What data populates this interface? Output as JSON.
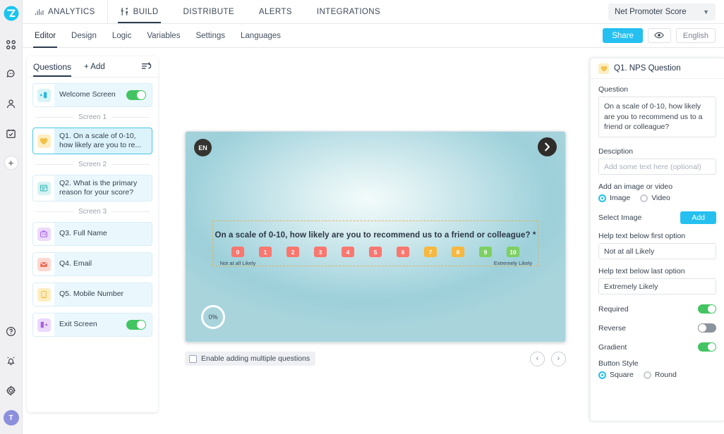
{
  "brand": {
    "accent": "#25c0f0",
    "dark": "#2b3a4d",
    "green": "#43c463"
  },
  "rail": {
    "logo_label": "zonka-logo",
    "items": [
      {
        "name": "apps-grid-icon"
      },
      {
        "name": "chat-bubble-icon"
      },
      {
        "name": "person-icon"
      },
      {
        "name": "calendar-check-icon"
      }
    ],
    "add_label": "+",
    "bottom": [
      {
        "name": "help-circle-icon"
      },
      {
        "name": "bell-icon"
      },
      {
        "name": "gear-icon"
      }
    ],
    "avatar_initial": "T"
  },
  "topbar": {
    "nav": [
      {
        "label": "ANALYTICS",
        "icon": "bar-chart-icon",
        "active": false
      },
      {
        "label": "BUILD",
        "icon": "wrench-tools-icon",
        "active": true
      },
      {
        "label": "DISTRIBUTE",
        "icon": "",
        "active": false
      },
      {
        "label": "ALERTS",
        "icon": "",
        "active": false
      },
      {
        "label": "INTEGRATIONS",
        "icon": "",
        "active": false
      }
    ],
    "survey_select": {
      "value": "Net Promoter Score",
      "chevron": "chevron-down-icon"
    }
  },
  "subbar": {
    "tabs": [
      {
        "label": "Editor",
        "active": true
      },
      {
        "label": "Design",
        "active": false
      },
      {
        "label": "Logic",
        "active": false
      },
      {
        "label": "Variables",
        "active": false
      },
      {
        "label": "Settings",
        "active": false
      },
      {
        "label": "Languages",
        "active": false
      }
    ],
    "share_label": "Share",
    "preview_icon": "eye-icon",
    "language_label": "English"
  },
  "questions_panel": {
    "title": "Questions",
    "add_label": "+ Add",
    "reorder_icon": "reorder-undo-icon",
    "items": [
      {
        "kind": "screen",
        "label": "Welcome Screen",
        "icon": "welcome-screen-icon",
        "icon_bg": "#d8f4f7",
        "icon_color": "#2bb8d6",
        "toggle": true
      },
      {
        "kind": "separator",
        "label": "Screen 1"
      },
      {
        "kind": "question",
        "label": "Q1. On a scale of 0-10, how likely are you to re...",
        "icon": "heart-icon",
        "icon_bg": "#fdeec2",
        "icon_color": "#f3c14a",
        "selected": true
      },
      {
        "kind": "separator",
        "label": "Screen 2"
      },
      {
        "kind": "question",
        "label": "Q2. What is the primary reason for your score?",
        "icon": "comment-box-icon",
        "icon_bg": "#d7f3f2",
        "icon_color": "#3ab9bd",
        "selected": false
      },
      {
        "kind": "separator",
        "label": "Screen 3"
      },
      {
        "kind": "question",
        "label": "Q3. Full Name",
        "icon": "id-badge-icon",
        "icon_bg": "#ecd9fb",
        "icon_color": "#a861e8",
        "selected": false
      },
      {
        "kind": "question",
        "label": "Q4. Email",
        "icon": "envelope-icon",
        "icon_bg": "#fbd9d2",
        "icon_color": "#ee6a52",
        "selected": false
      },
      {
        "kind": "question",
        "label": "Q5. Mobile Number",
        "icon": "mobile-phone-icon",
        "icon_bg": "#fdeec2",
        "icon_color": "#f0bb3e",
        "selected": false
      },
      {
        "kind": "screen",
        "label": "Exit Screen",
        "icon": "exit-screen-icon",
        "icon_bg": "#ecd9fb",
        "icon_color": "#a861e8",
        "toggle": true
      }
    ]
  },
  "preview": {
    "language_badge": "EN",
    "next_icon": "chevron-right-circle-icon",
    "question_text": "On a scale of 0-10, how likely are you to recommend us to a friend or colleague? *",
    "scale": [
      {
        "value": "0",
        "color": "#f9776f"
      },
      {
        "value": "1",
        "color": "#f9776f"
      },
      {
        "value": "2",
        "color": "#f9776f"
      },
      {
        "value": "3",
        "color": "#f9776f"
      },
      {
        "value": "4",
        "color": "#f9776f"
      },
      {
        "value": "5",
        "color": "#f9776f"
      },
      {
        "value": "6",
        "color": "#f9776f"
      },
      {
        "value": "7",
        "color": "#f7b83f"
      },
      {
        "value": "8",
        "color": "#f7b83f"
      },
      {
        "value": "9",
        "color": "#7ed063"
      },
      {
        "value": "10",
        "color": "#7ed063"
      }
    ],
    "first_help": "Not at all Likely",
    "last_help": "Extremely Likely",
    "progress_label": "0%",
    "multi_question_label": "Enable adding multiple questions",
    "multi_question_checked": false,
    "prev_icon": "chevron-left-icon",
    "next_arrow_icon": "chevron-right-icon"
  },
  "settings_panel": {
    "header_title": "Q1. NPS Question",
    "header_icon": "heart-icon",
    "question_label": "Question",
    "question_value": "On a scale of 0-10, how likely are you to recommend us to a friend or colleague?",
    "description_label": "Desciption",
    "description_value": "",
    "description_placeholder": "Add some text here (optional)",
    "media_label": "Add an image or video",
    "media_options": [
      {
        "label": "Image",
        "selected": true
      },
      {
        "label": "Video",
        "selected": false
      }
    ],
    "select_image_label": "Select Image",
    "add_button_label": "Add",
    "first_help_label": "Help text below first option",
    "first_help_value": "Not at all Likely",
    "last_help_label": "Help text below last option",
    "last_help_value": "Extremely Likely",
    "toggles": [
      {
        "label": "Required",
        "on": true
      },
      {
        "label": "Reverse",
        "on": false
      },
      {
        "label": "Gradient",
        "on": true
      }
    ],
    "button_style_label": "Button Style",
    "button_style_options": [
      {
        "label": "Square",
        "selected": true
      },
      {
        "label": "Round",
        "selected": false
      }
    ]
  }
}
